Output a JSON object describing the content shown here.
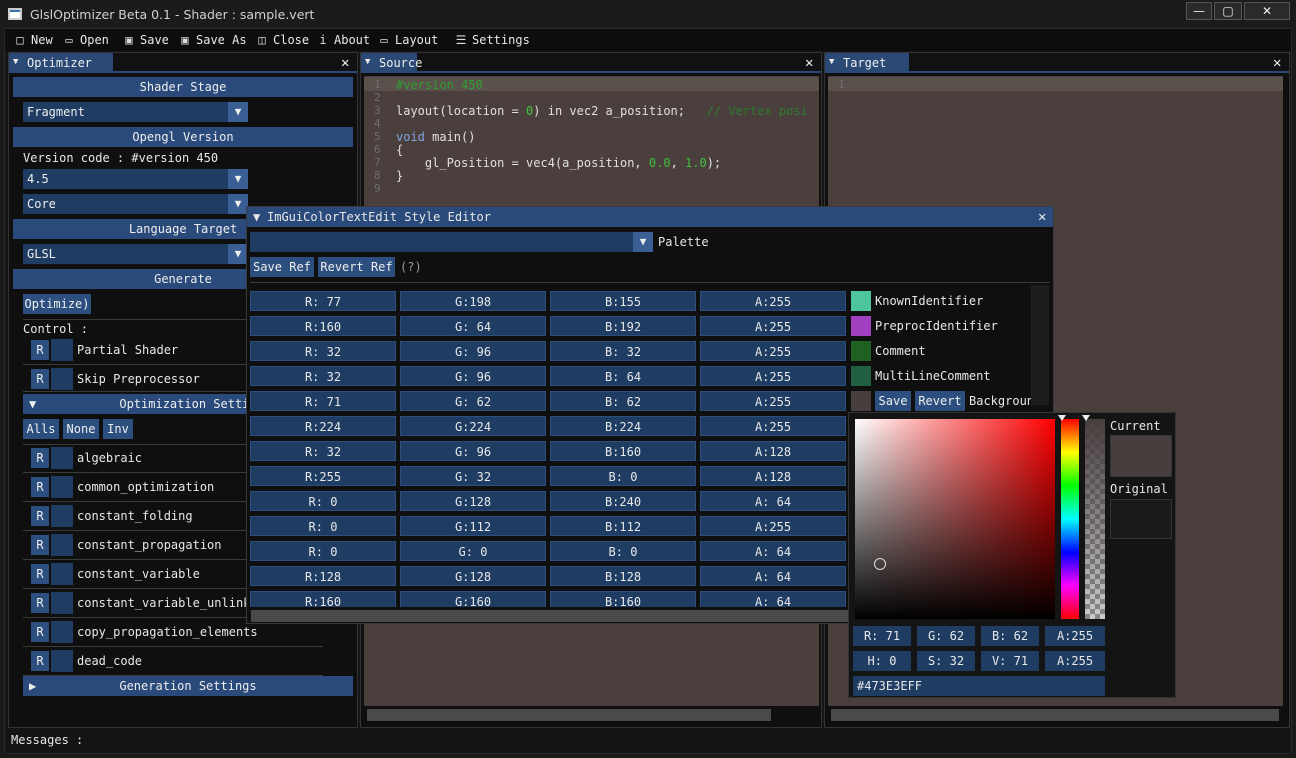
{
  "window": {
    "title": "GlslOptimizer Beta 0.1 - Shader : sample.vert"
  },
  "menu": [
    {
      "label": "New",
      "icon": "new-file-icon",
      "glyph": "🗋"
    },
    {
      "label": "Open",
      "icon": "open-folder-icon",
      "glyph": "🗁"
    },
    {
      "label": "Save",
      "icon": "save-icon",
      "glyph": "🖫"
    },
    {
      "label": "Save As",
      "icon": "save-as-icon",
      "glyph": "🖫"
    },
    {
      "label": "Close",
      "icon": "trash-icon",
      "glyph": "🗑"
    },
    {
      "label": "About",
      "icon": "info-icon",
      "glyph": "ℹ"
    },
    {
      "label": "Layout",
      "icon": "monitor-icon",
      "glyph": "🖵"
    },
    {
      "label": "Settings",
      "icon": "sliders-icon",
      "glyph": "☰"
    }
  ],
  "optimizer": {
    "tab": "Optimizer",
    "shader_stage_header": "Shader Stage",
    "shader_stage_value": "Fragment",
    "opengl_header": "Opengl Version",
    "version_code": "Version code : #version 450",
    "version_value": "4.5",
    "profile_value": "Core",
    "language_header": "Language Target",
    "language_value": "GLSL",
    "generate_header": "Generate",
    "optimize_button": "Optimize)",
    "control_label": "Control :",
    "controls": [
      {
        "r": "R",
        "label": "Partial Shader"
      },
      {
        "r": "R",
        "label": "Skip Preprocessor"
      }
    ],
    "opt_settings_header": "Optimization Settin",
    "alls": "Alls",
    "none": "None",
    "inv": "Inv",
    "options": [
      {
        "r": "R",
        "label": "algebraic"
      },
      {
        "r": "R",
        "label": "common_optimization"
      },
      {
        "r": "R",
        "label": "constant_folding"
      },
      {
        "r": "R",
        "label": "constant_propagation"
      },
      {
        "r": "R",
        "label": "constant_variable"
      },
      {
        "r": "R",
        "label": "constant_variable_unlink"
      },
      {
        "r": "R",
        "label": "copy_propagation_elements"
      },
      {
        "r": "R",
        "label": "dead_code"
      }
    ],
    "generation_header": "Generation Settings"
  },
  "source": {
    "tab": "Source",
    "line_numbers": [
      "1",
      "2",
      "3",
      "4",
      "5",
      "6",
      "7",
      "8",
      "9"
    ],
    "lines": [
      {
        "parts": [
          {
            "t": "#version 450",
            "c": "#2fa02f"
          }
        ]
      },
      {
        "parts": []
      },
      {
        "parts": [
          {
            "t": "layout(location = ",
            "c": "#e0e0e0"
          },
          {
            "t": "0",
            "c": "#40c040"
          },
          {
            "t": ") in vec2 a_position;   ",
            "c": "#e0e0e0"
          },
          {
            "t": "// Vertex posi",
            "c": "#2f7a2f"
          }
        ]
      },
      {
        "parts": []
      },
      {
        "parts": [
          {
            "t": "void",
            "c": "#7fa4e0"
          },
          {
            "t": " main()",
            "c": "#e0e0e0"
          }
        ]
      },
      {
        "parts": [
          {
            "t": "{",
            "c": "#e0e0e0"
          }
        ]
      },
      {
        "parts": [
          {
            "t": "    gl_Position = vec4(a_position, ",
            "c": "#e0e0e0"
          },
          {
            "t": "0.0",
            "c": "#40c040"
          },
          {
            "t": ", ",
            "c": "#e0e0e0"
          },
          {
            "t": "1.0",
            "c": "#40c040"
          },
          {
            "t": ");",
            "c": "#e0e0e0"
          }
        ]
      },
      {
        "parts": [
          {
            "t": "}",
            "c": "#e0e0e0"
          }
        ]
      },
      {
        "parts": []
      }
    ]
  },
  "target": {
    "tab": "Target",
    "line_numbers": [
      "1"
    ]
  },
  "style_editor": {
    "title": "ImGuiColorTextEdit Style Editor",
    "palette_label": "Palette",
    "save_ref": "Save Ref",
    "revert_ref": "Revert Ref",
    "help": "(?)",
    "rows": [
      {
        "r": "R: 77",
        "g": "G:198",
        "b": "B:155",
        "a": "A:255",
        "color": "#4dc69b",
        "name": "KnownIdentifier"
      },
      {
        "r": "R:160",
        "g": "G: 64",
        "b": "B:192",
        "a": "A:255",
        "color": "#a040c0",
        "name": "PreprocIdentifier"
      },
      {
        "r": "R: 32",
        "g": "G: 96",
        "b": "B: 32",
        "a": "A:255",
        "color": "#206020",
        "name": "Comment"
      },
      {
        "r": "R: 32",
        "g": "G: 96",
        "b": "B: 64",
        "a": "A:255",
        "color": "#206040",
        "name": "MultiLineComment"
      },
      {
        "r": "R: 71",
        "g": "G: 62",
        "b": "B: 62",
        "a": "A:255",
        "color": "#473e3e",
        "name": "Backgroun"
      },
      {
        "r": "R:224",
        "g": "G:224",
        "b": "B:224",
        "a": "A:255"
      },
      {
        "r": "R: 32",
        "g": "G: 96",
        "b": "B:160",
        "a": "A:128"
      },
      {
        "r": "R:255",
        "g": "G: 32",
        "b": "B:  0",
        "a": "A:128"
      },
      {
        "r": "R:  0",
        "g": "G:128",
        "b": "B:240",
        "a": "A: 64"
      },
      {
        "r": "R:  0",
        "g": "G:112",
        "b": "B:112",
        "a": "A:255"
      },
      {
        "r": "R:  0",
        "g": "G:  0",
        "b": "B:  0",
        "a": "A: 64"
      },
      {
        "r": "R:128",
        "g": "G:128",
        "b": "B:128",
        "a": "A: 64"
      },
      {
        "r": "R:160",
        "g": "G:160",
        "b": "B:160",
        "a": "A: 64"
      }
    ],
    "bg_save": "Save",
    "bg_revert": "Revert"
  },
  "picker": {
    "current_label": "Current",
    "original_label": "Original",
    "current_color": "#473e3e",
    "original_color": "#1a1a1a",
    "hue_color": "#ff0000",
    "r": "R: 71",
    "g": "G: 62",
    "b": "B: 62",
    "a": "A:255",
    "h": "H:  0",
    "s": "S: 32",
    "v": "V: 71",
    "a2": "A:255",
    "hex": "#473E3EFF"
  },
  "status": {
    "messages": "Messages :"
  }
}
